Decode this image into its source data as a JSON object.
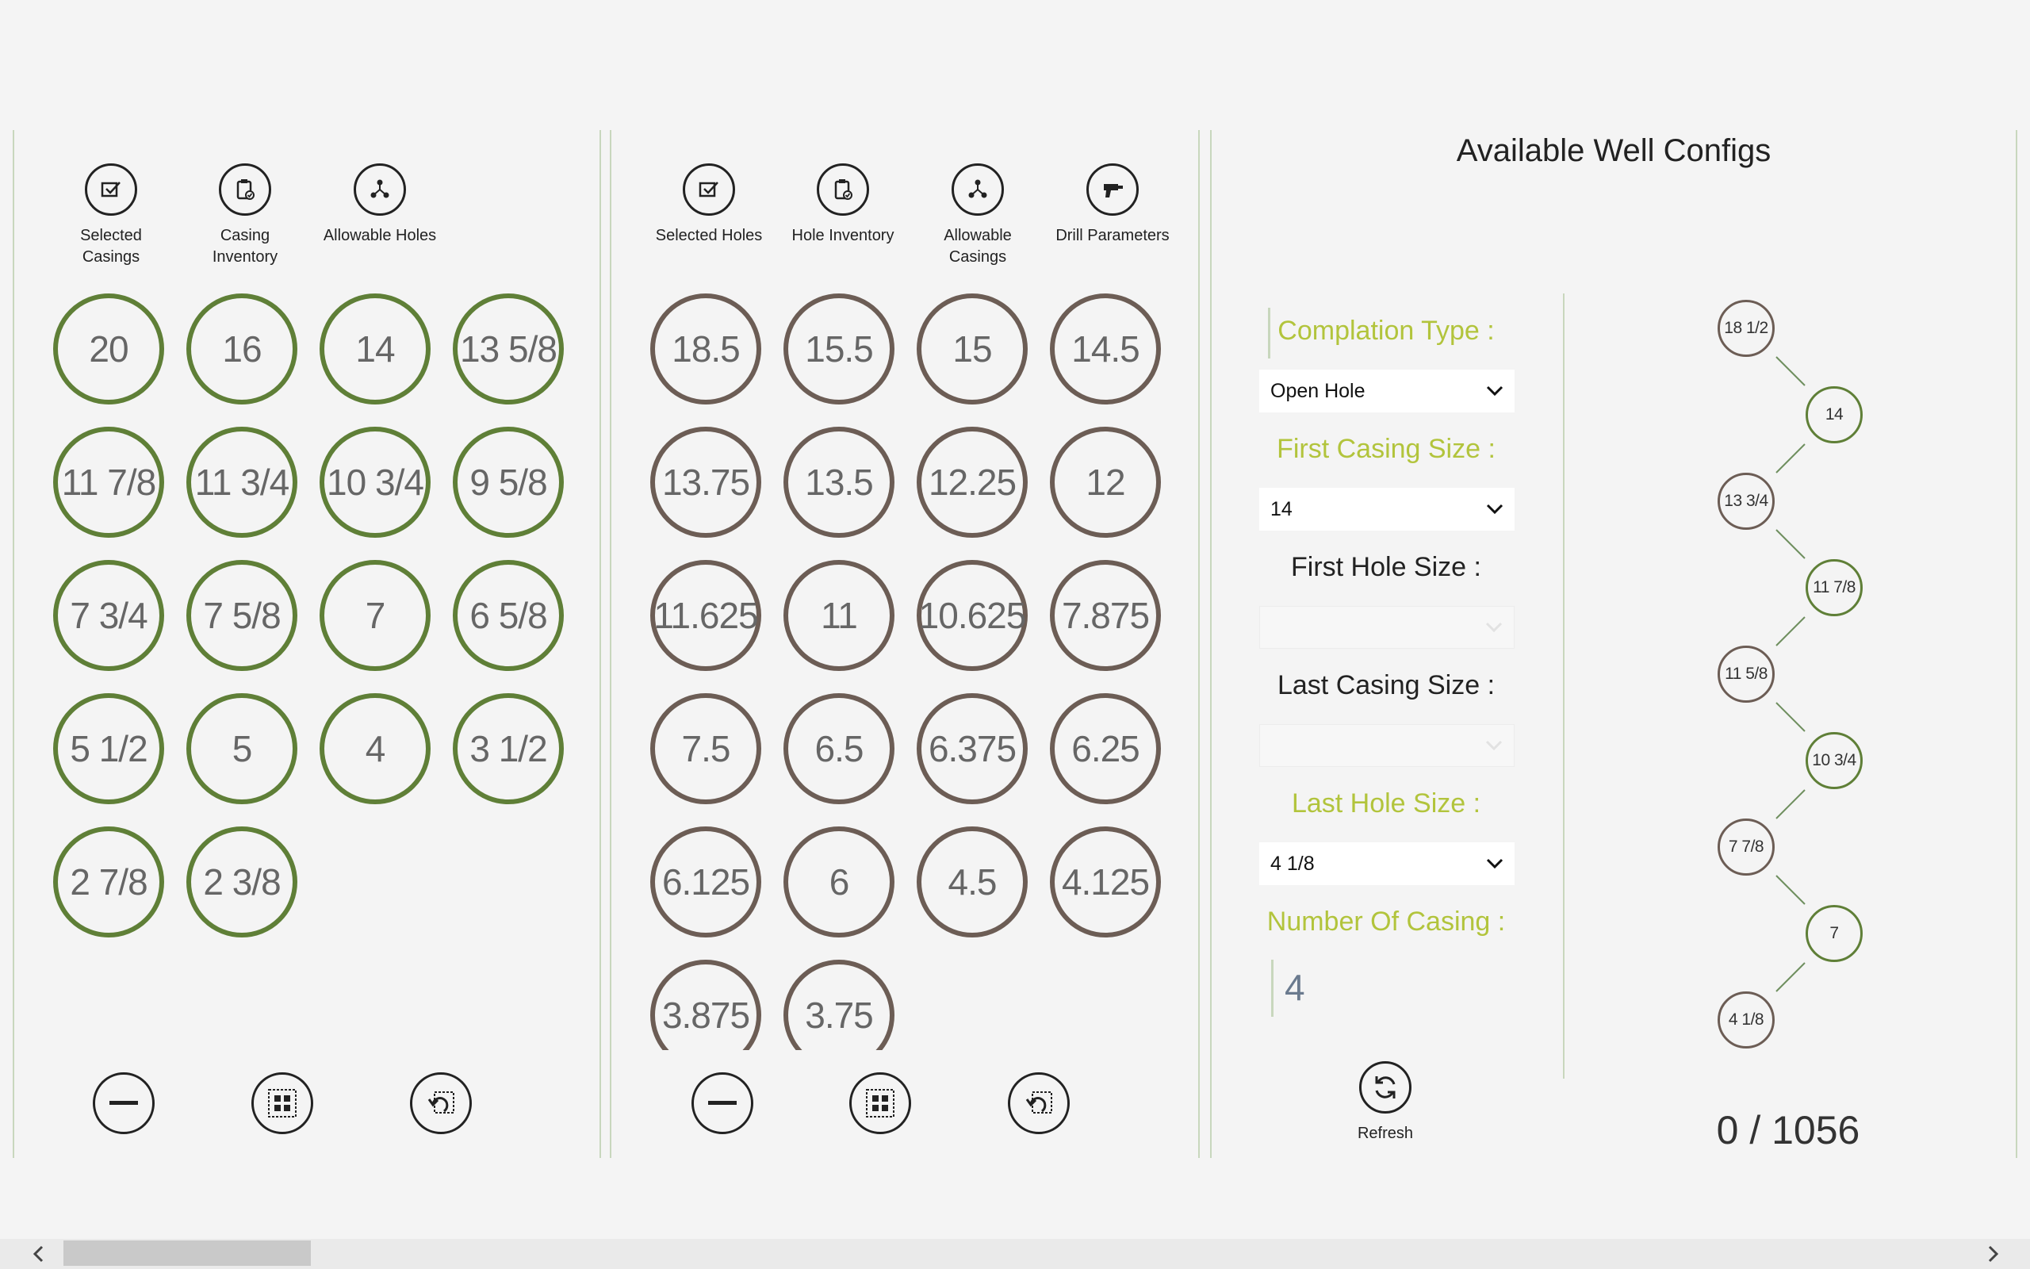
{
  "casing_panel": {
    "toolbar": [
      {
        "label": "Selected\nCasings",
        "icon": "selected-casings-icon"
      },
      {
        "label": "Casing\nInventory",
        "icon": "casing-inventory-icon"
      },
      {
        "label": "Allowable Holes",
        "icon": "allowable-holes-icon"
      }
    ],
    "sizes": [
      "20",
      "16",
      "14",
      "13 5/8",
      "11 7/8",
      "11 3/4",
      "10 3/4",
      "9 5/8",
      "7 3/4",
      "7 5/8",
      "7",
      "6 5/8",
      "5 1/2",
      "5",
      "4",
      "3 1/2",
      "2 7/8",
      "2 3/8"
    ],
    "actions": [
      {
        "icon": "remove-icon"
      },
      {
        "icon": "select-all-icon"
      },
      {
        "icon": "undo-icon"
      }
    ]
  },
  "hole_panel": {
    "toolbar": [
      {
        "label": "Selected Holes",
        "icon": "selected-holes-icon"
      },
      {
        "label": "Hole Inventory",
        "icon": "hole-inventory-icon"
      },
      {
        "label": "Allowable\nCasings",
        "icon": "allowable-casings-icon"
      },
      {
        "label": "Drill Parameters",
        "icon": "drill-icon"
      }
    ],
    "sizes": [
      "18.5",
      "15.5",
      "15",
      "14.5",
      "13.75",
      "13.5",
      "12.25",
      "12",
      "11.625",
      "11",
      "10.625",
      "7.875",
      "7.5",
      "6.5",
      "6.375",
      "6.25",
      "6.125",
      "6",
      "4.5",
      "4.125",
      "3.875",
      "3.75"
    ],
    "actions": [
      {
        "icon": "remove-icon"
      },
      {
        "icon": "select-all-icon"
      },
      {
        "icon": "undo-icon"
      }
    ]
  },
  "configs_panel": {
    "title": "Available Well Configs",
    "completion_type": {
      "label": "Complation Type :",
      "value": "Open Hole"
    },
    "first_casing": {
      "label": "First Casing Size :",
      "value": "14"
    },
    "first_hole": {
      "label": "First Hole Size :",
      "value": ""
    },
    "last_casing": {
      "label": "Last Casing Size :",
      "value": ""
    },
    "last_hole": {
      "label": "Last Hole Size :",
      "value": "4 1/8"
    },
    "number_of_casing": {
      "label": "Number Of Casing :",
      "value": "4"
    },
    "refresh_label": "Refresh",
    "counter": "0 / 1056",
    "tree": [
      {
        "label": "18 1/2",
        "kind": "hole"
      },
      {
        "label": "14",
        "kind": "casing"
      },
      {
        "label": "13 3/4",
        "kind": "hole"
      },
      {
        "label": "11 7/8",
        "kind": "casing"
      },
      {
        "label": "11 5/8",
        "kind": "hole"
      },
      {
        "label": "10 3/4",
        "kind": "casing"
      },
      {
        "label": "7 7/8",
        "kind": "hole"
      },
      {
        "label": "7",
        "kind": "casing"
      },
      {
        "label": "4 1/8",
        "kind": "hole"
      }
    ]
  },
  "colors": {
    "casing": "#5f7f37",
    "hole": "#6c5d55",
    "accent": "#b2c43c",
    "divider": "#c8d7bd"
  },
  "scrollbar": {
    "left_icon": "chevron-left-icon",
    "right_icon": "chevron-right-icon"
  }
}
